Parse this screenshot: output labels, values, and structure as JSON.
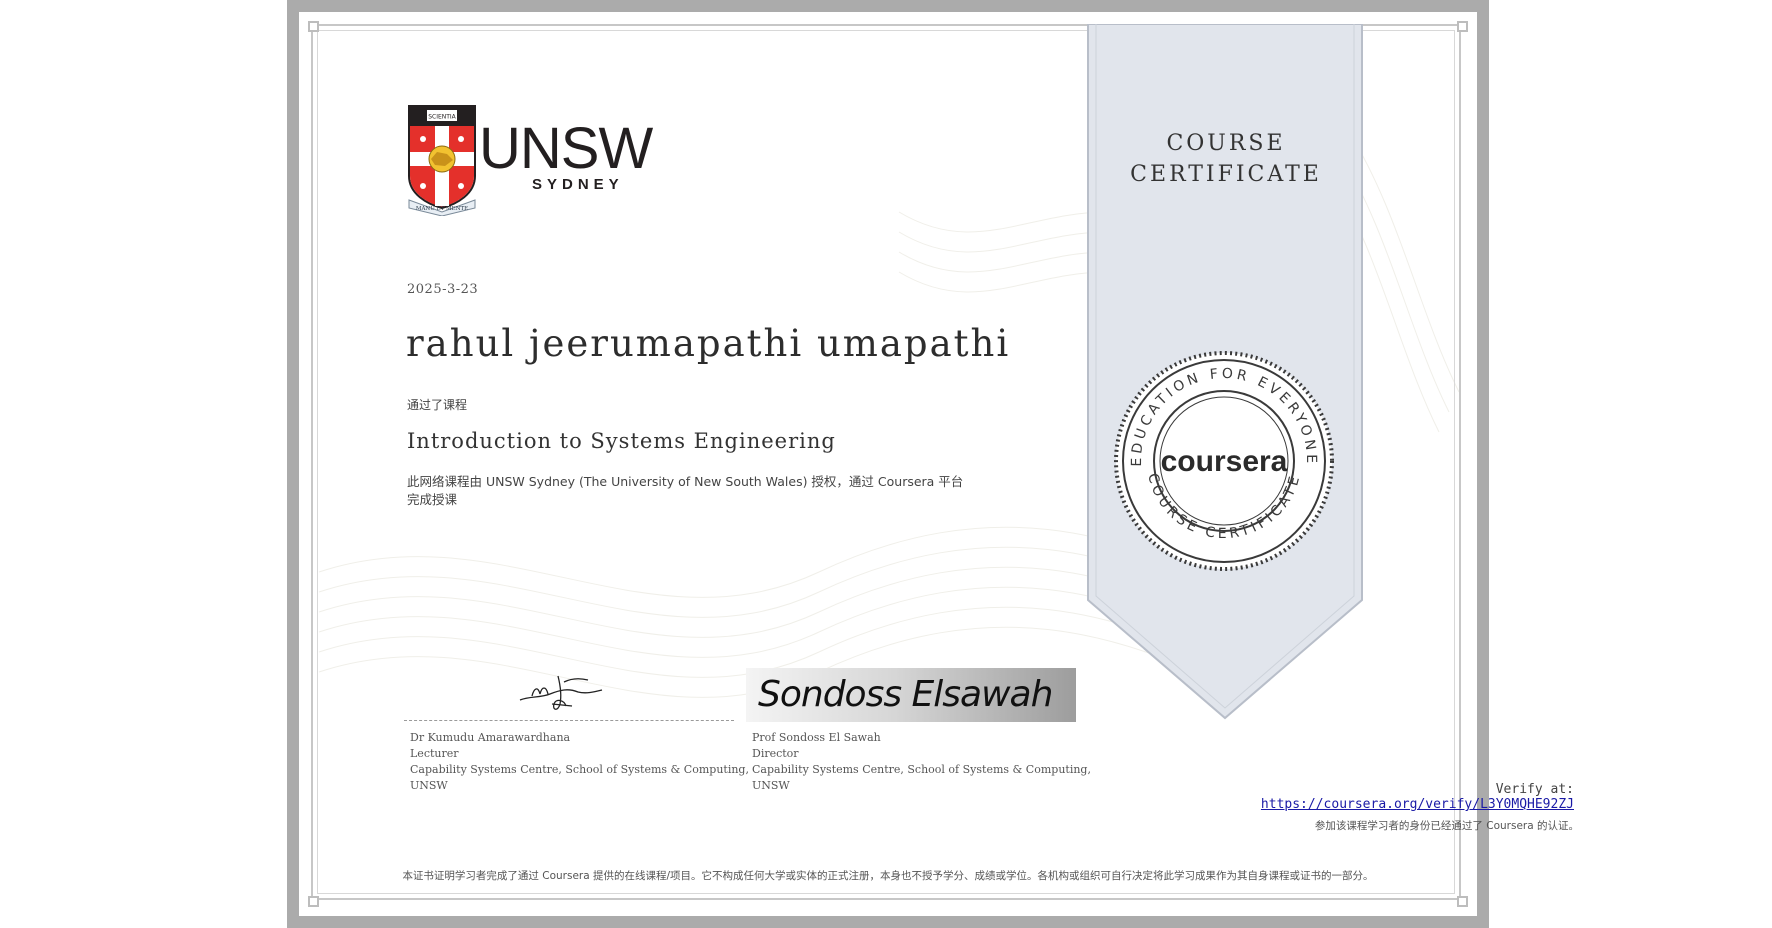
{
  "certificate": {
    "issuer": {
      "wordmark": "UNSW",
      "subtitle": "SYDNEY",
      "crest_motto": "MANU ET MENTE",
      "crest_book_text": "SCIENTIA"
    },
    "ribbon": {
      "line1": "COURSE",
      "line2": "CERTIFICATE"
    },
    "date": "2025-3-23",
    "recipient_name": "rahul jeerumapathi umapathi",
    "completed_label": "通过了课程",
    "course_title": "Introduction to Systems Engineering",
    "description": "此网络课程由 UNSW Sydney (The University of New South Wales) 授权，通过 Coursera 平台完成授课",
    "seal": {
      "brand": "coursera",
      "top_arc": "EDUCATION FOR EVERYONE",
      "bottom_arc": "COURSE CERTIFICATE"
    },
    "signatories": [
      {
        "signature_text": "Sondoss",
        "name": "Dr Kumudu Amarawardhana",
        "role": "Lecturer",
        "org_line1": "Capability Systems Centre, School of Systems & Computing,",
        "org_line2": "UNSW"
      },
      {
        "signature_text": "Sondoss Elsawah",
        "name": "Prof Sondoss El Sawah",
        "role": "Director",
        "org_line1": "Capability Systems Centre, School of Systems & Computing,",
        "org_line2": "UNSW"
      }
    ],
    "verify": {
      "label": "Verify at:",
      "url": "https://coursera.org/verify/L3Y0MQHE92ZJ",
      "note": "参加该课程学习者的身份已经通过了 Coursera 的认证。"
    },
    "footer": "本证书证明学习者完成了通过 Coursera 提供的在线课程/项目。它不构成任何大学或实体的正式注册，本身也不授予学分、成绩或学位。各机构或组织可自行决定将此学习成果作为其自身课程或证书的一部分。"
  },
  "colors": {
    "frame": "#ababab",
    "ribbon": "#e1e5ec",
    "ribbon_edge": "#b8bec9",
    "unsw_red": "#e4302b",
    "crest_gold": "#f2c230",
    "link": "#1a1aa6"
  }
}
